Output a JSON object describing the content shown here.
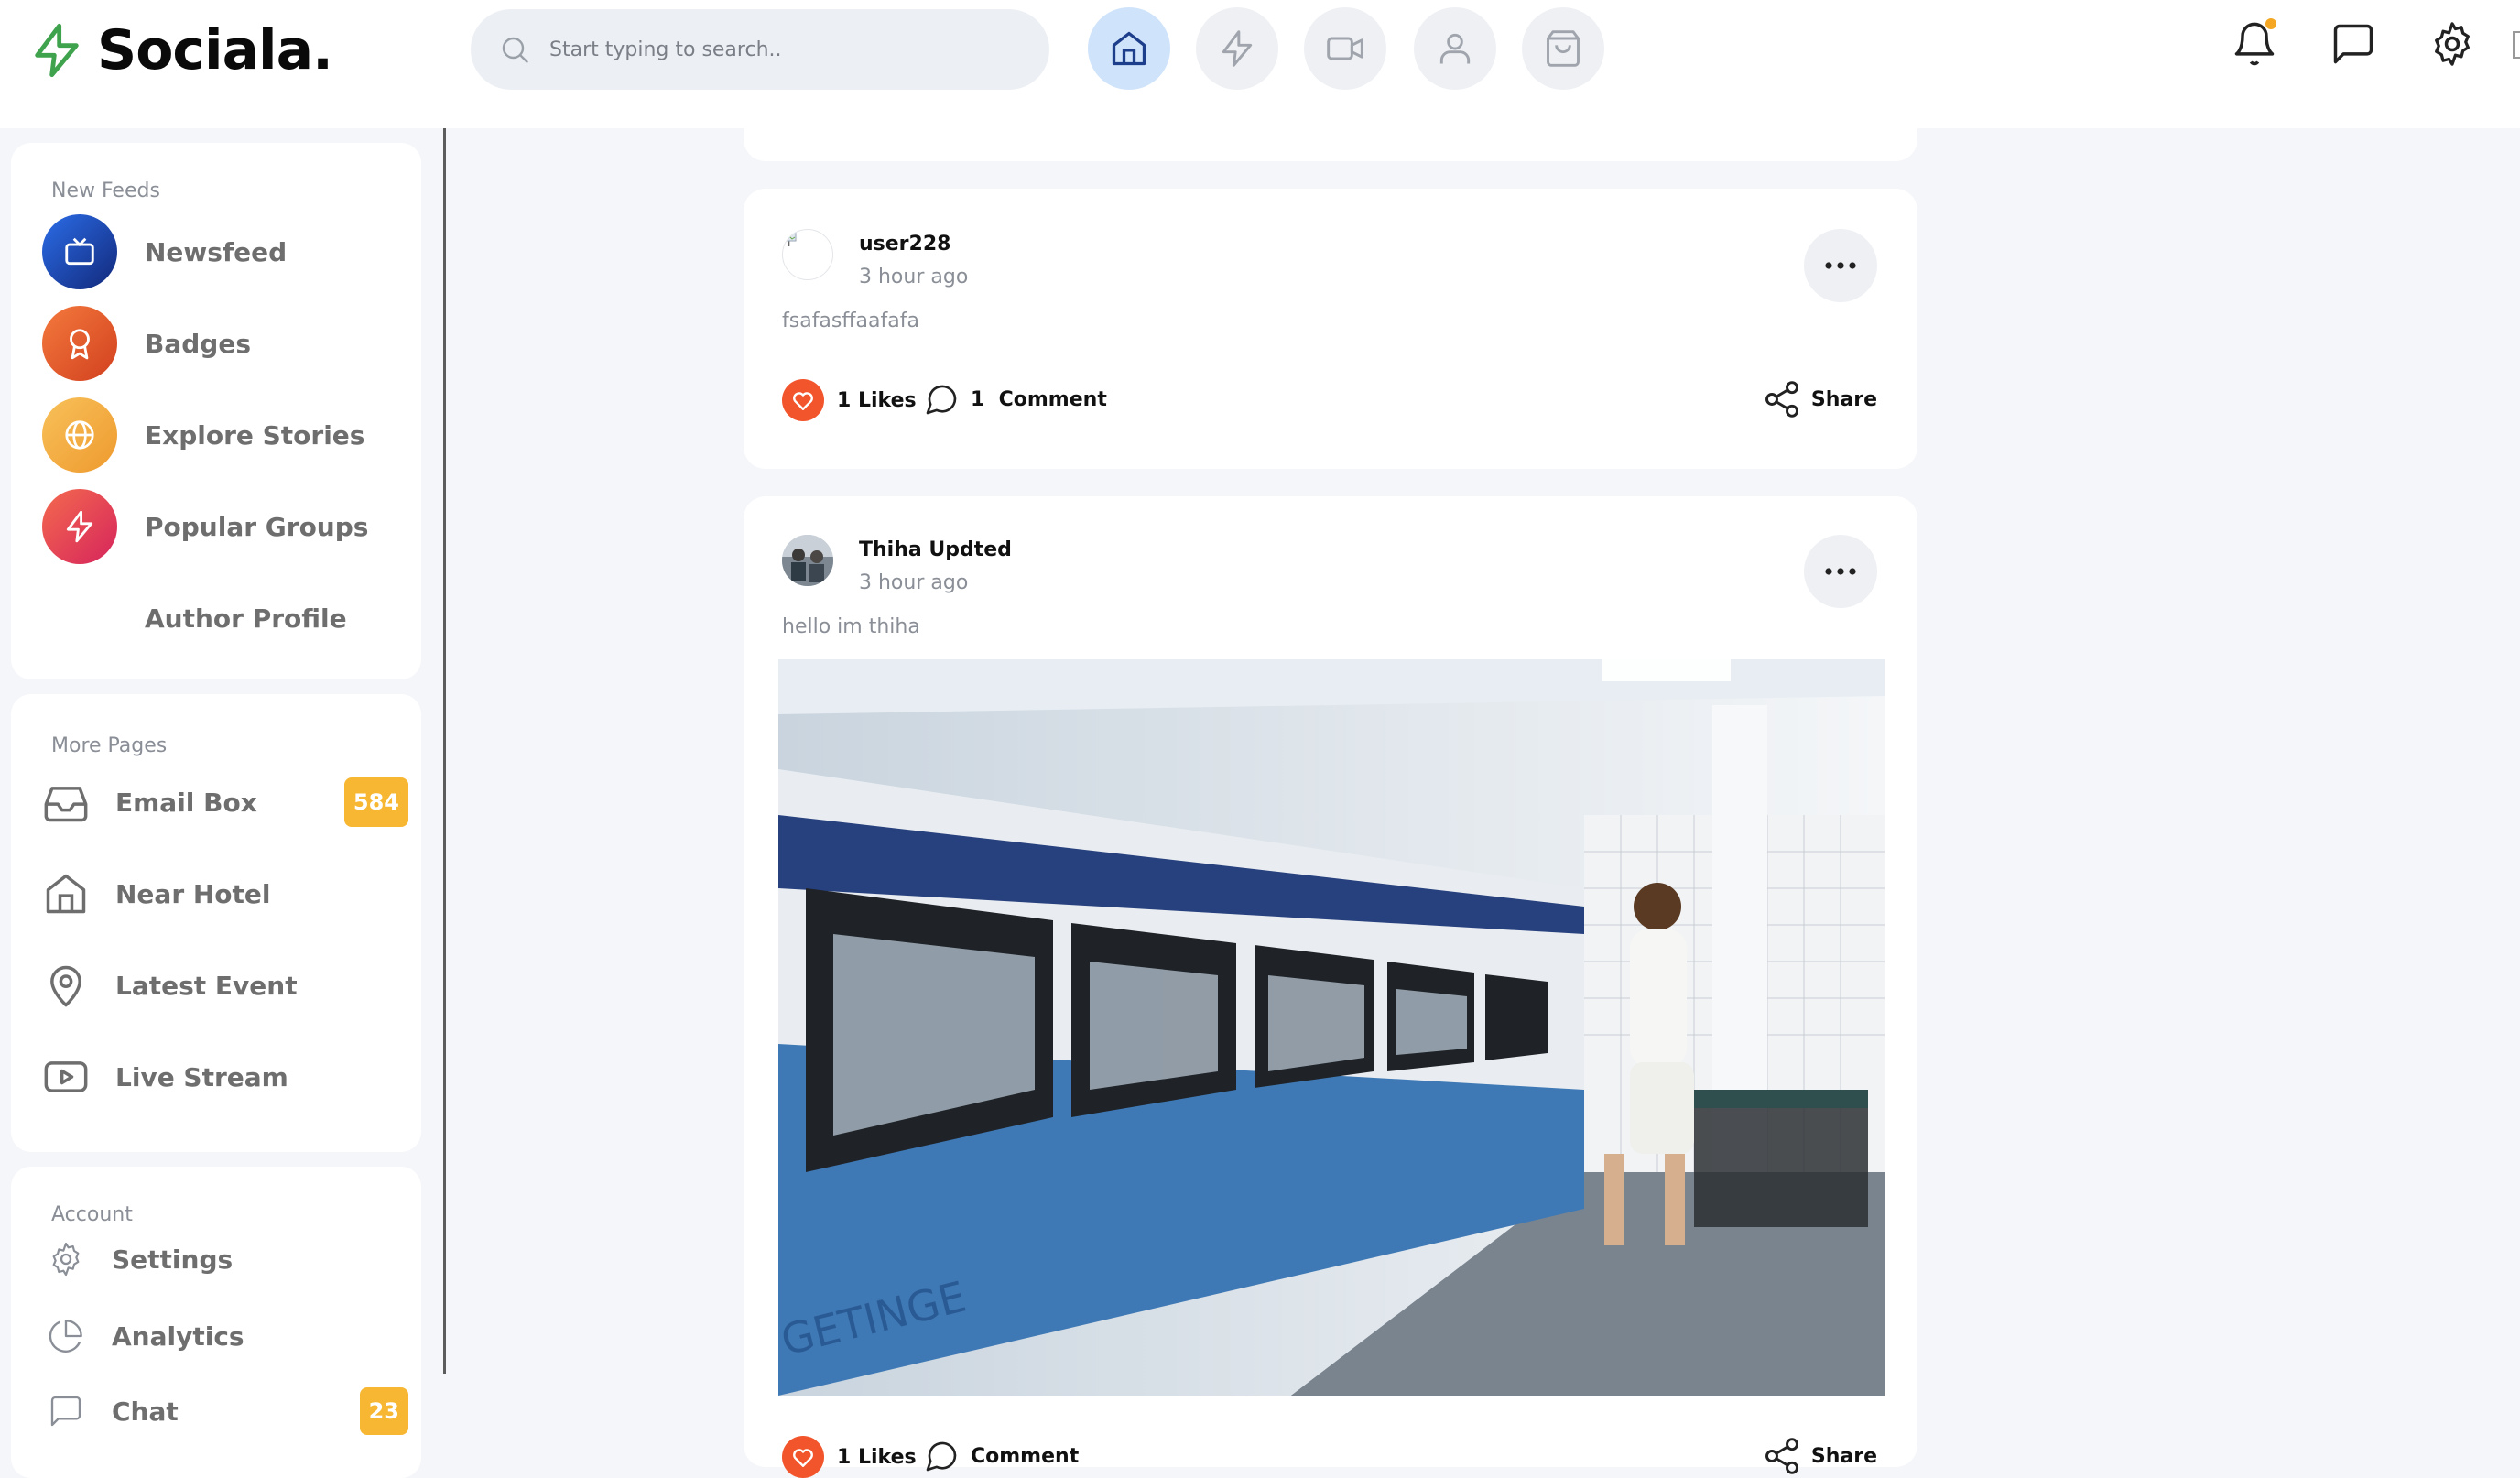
{
  "brand": {
    "name": "Sociala.",
    "accent": "#3fa34d"
  },
  "search": {
    "placeholder": "Start typing to search.."
  },
  "topnav": {
    "items": [
      {
        "icon": "home-icon",
        "active": true
      },
      {
        "icon": "zap-icon",
        "active": false
      },
      {
        "icon": "video-icon",
        "active": false
      },
      {
        "icon": "user-icon",
        "active": false
      },
      {
        "icon": "shopping-bag-icon",
        "active": false
      }
    ],
    "right_icons": [
      "bell-icon",
      "message-icon",
      "settings-icon"
    ]
  },
  "sidebar": {
    "feeds_title": "New Feeds",
    "feeds": [
      {
        "label": "Newsfeed",
        "icon": "tv-icon",
        "color": "#1e4fc1"
      },
      {
        "label": "Badges",
        "icon": "award-icon",
        "color": "#e55a2b"
      },
      {
        "label": "Explore Stories",
        "icon": "globe-icon",
        "color": "#f2a93b"
      },
      {
        "label": "Popular Groups",
        "icon": "zap-icon",
        "color": "#e83e5a"
      },
      {
        "label": "Author Profile",
        "icon": "",
        "color": ""
      }
    ],
    "pages_title": "More Pages",
    "pages": [
      {
        "label": "Email Box",
        "icon": "inbox-icon",
        "badge": "584"
      },
      {
        "label": "Near Hotel",
        "icon": "home-icon",
        "badge": ""
      },
      {
        "label": "Latest Event",
        "icon": "map-pin-icon",
        "badge": ""
      },
      {
        "label": "Live Stream",
        "icon": "youtube-icon",
        "badge": ""
      }
    ],
    "account_title": "Account",
    "account": [
      {
        "label": "Settings",
        "icon": "settings-icon",
        "badge": ""
      },
      {
        "label": "Analytics",
        "icon": "pie-chart-icon",
        "badge": ""
      },
      {
        "label": "Chat",
        "icon": "message-square-icon",
        "badge": "23"
      }
    ]
  },
  "posts": [
    {
      "user": "user228",
      "time": "3 hour ago",
      "text": "fsafasffaafafa",
      "avatar_alt": "i",
      "likes": "1 Likes",
      "comments": "1  Comment",
      "share": "Share"
    },
    {
      "user": "Thiha Updted",
      "time": "3 hour ago",
      "text": "hello im thiha",
      "likes": "1 Likes",
      "comments": "Comment",
      "share": "Share",
      "photo_caption": "GETINGE"
    }
  ]
}
